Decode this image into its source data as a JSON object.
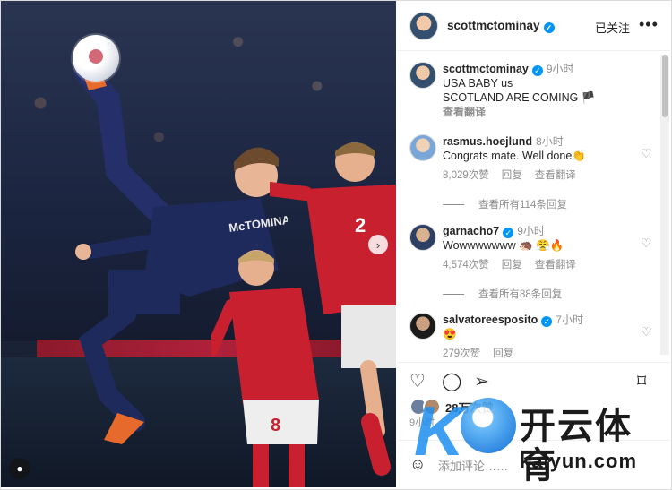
{
  "post": {
    "username": "scottmctominay",
    "follow_label": "已关注",
    "more_label": "•••",
    "caption_time": "9小时",
    "caption_lines": [
      "USA BABY us",
      "SCOTLAND ARE COMING 🏴"
    ],
    "caption_translate": "查看翻译",
    "shirt_name": "McTOMINAY",
    "shirt_number_red": "2",
    "shirt_number_red2": "8"
  },
  "comments": [
    {
      "user": "rasmus.hoejlund",
      "time": "8小时",
      "text": "Congrats mate. Well done👏",
      "likes": "8,029次赞",
      "reply": "回复",
      "translate": "查看翻译",
      "view_replies": "查看所有114条回复"
    },
    {
      "user": "garnacho7",
      "time": "9小时",
      "text": "Wowwwwwww 🦔 😤🔥",
      "likes": "4,574次赞",
      "reply": "回复",
      "translate": "查看翻译",
      "view_replies": "查看所有88条回复"
    },
    {
      "user": "salvatoreesposito",
      "time": "7小时",
      "text": "😍",
      "likes": "279次赞",
      "reply": "回复"
    }
  ],
  "likes_count": "28万次赞",
  "time_ago": "9小时",
  "add_comment_placeholder": "添加评论……",
  "watermark": {
    "title": "开云体育",
    "url": "kaiyun.com"
  },
  "colors": {
    "verified": "#0095f6",
    "red_kit": "#c8202f",
    "navy_kit": "#1f2a5c"
  }
}
